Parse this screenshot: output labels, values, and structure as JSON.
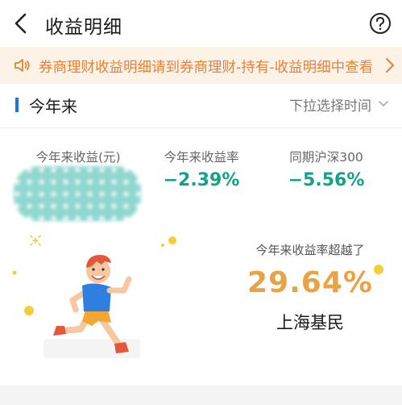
{
  "header": {
    "title": "收益明细",
    "back_icon": "chevron-left-icon",
    "help_icon": "question-circle-icon"
  },
  "notice": {
    "text": "券商理财收益明细请到券商理财-持有-收益明细中查看",
    "icon": "speaker-icon",
    "arrow_icon": "chevron-right-icon",
    "color": "#e5823b",
    "background": "#fdf2e6"
  },
  "period": {
    "title": "今年来",
    "dropdown_label": "下拉选择时间",
    "dropdown_icon": "chevron-down-icon",
    "accent_color": "#1f74d6"
  },
  "stats": {
    "income_label": "今年来收益(元)",
    "return_label": "今年来收益率",
    "return_value": "−2.39%",
    "index_label": "同期沪深300",
    "index_value": "−5.56%",
    "value_color": "#12a289"
  },
  "ranking": {
    "label": "今年来收益率超越了",
    "percent": "29.64%",
    "group": "上海基民",
    "color": "#e8a444"
  }
}
